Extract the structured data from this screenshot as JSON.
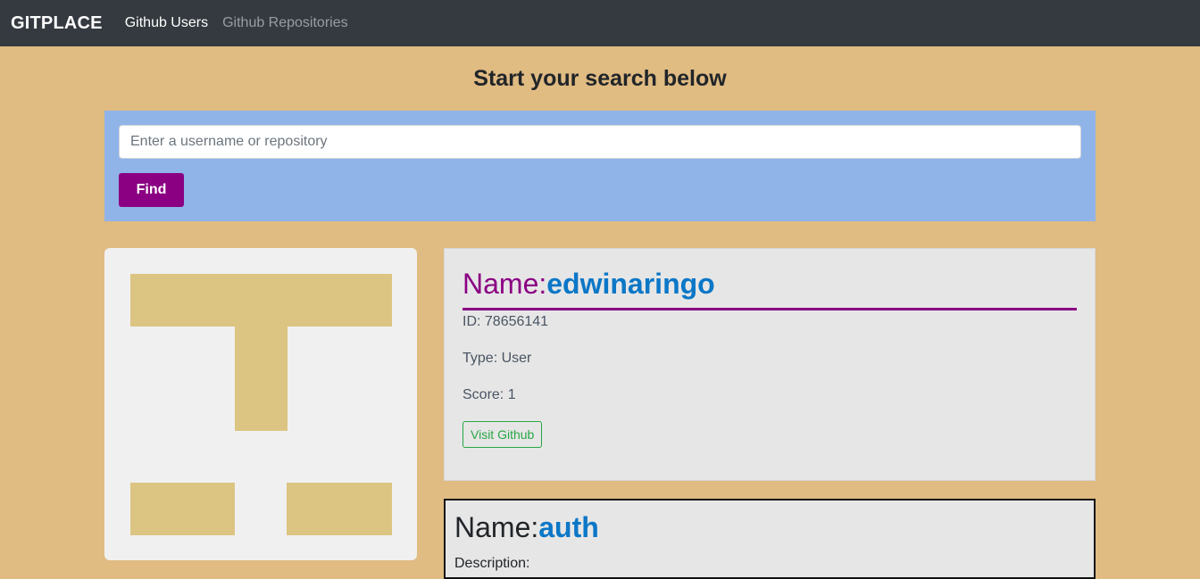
{
  "navbar": {
    "brand": "GITPLACE",
    "links": [
      {
        "label": "Github Users",
        "active": true
      },
      {
        "label": "Github Repositories",
        "active": false
      }
    ]
  },
  "search": {
    "heading": "Start your search below",
    "placeholder": "Enter a username or repository",
    "value": "",
    "button_label": "Find"
  },
  "user": {
    "name_label": "Name:",
    "name": "edwinaringo",
    "id_text": "ID: 78656141",
    "type_text": "Type: User",
    "score_text": "Score: 1",
    "visit_label": "Visit Github",
    "avatar_color": "#dcc582",
    "avatar_bg": "#f0f0f0"
  },
  "repo": {
    "name_label": "Name:",
    "name": "auth",
    "description_label": "Description:"
  },
  "colors": {
    "page_bg": "#e0bb82",
    "navbar_bg": "#343a40",
    "search_panel_bg": "#90b4e8",
    "accent_purple": "#8b0083",
    "link_blue": "#0b77c7",
    "success_green": "#28a745"
  }
}
